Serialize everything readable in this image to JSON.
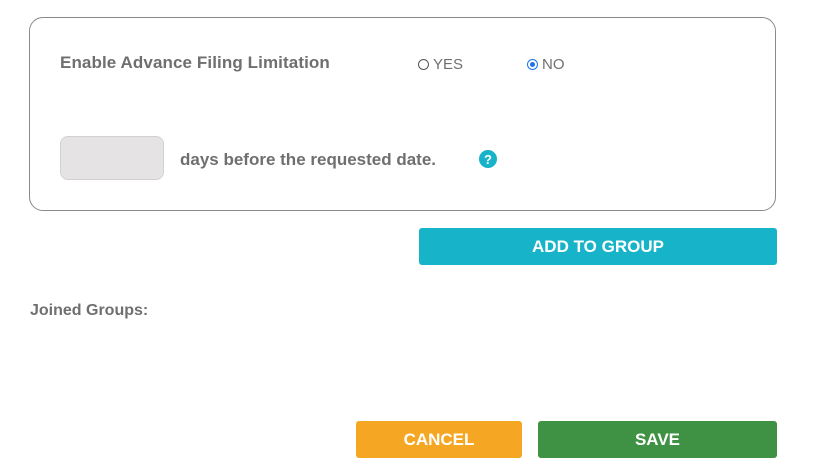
{
  "advance_filing": {
    "label": "Enable Advance Filing Limitation",
    "options": [
      {
        "label": "YES",
        "checked": false
      },
      {
        "label": "NO",
        "checked": true
      }
    ]
  },
  "days_field": {
    "value": "",
    "label": "days before the requested date."
  },
  "help": {
    "icon": "question-circle-icon",
    "glyph": "?",
    "color": "#17b3c8"
  },
  "add_group_button": {
    "label": "ADD TO GROUP",
    "color": "#17b3c8"
  },
  "joined_groups": {
    "label": "Joined Groups:"
  },
  "footer": {
    "cancel_label": "CANCEL",
    "cancel_color": "#f5a623",
    "save_label": "SAVE",
    "save_color": "#3f9143"
  }
}
